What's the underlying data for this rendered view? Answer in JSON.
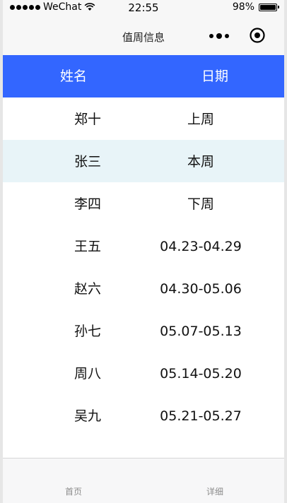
{
  "status_bar": {
    "carrier": "WeChat",
    "time": "22:55",
    "battery": "98%",
    "battery_level": 0.98
  },
  "nav": {
    "title": "值周信息",
    "more_icon": "more-dots-icon",
    "close_icon": "target-close-icon"
  },
  "table": {
    "headers": [
      "姓名",
      "日期"
    ],
    "rows": [
      {
        "name": "郑十",
        "date": "上周"
      },
      {
        "name": "张三",
        "date": "本周",
        "highlight": true
      },
      {
        "name": "李四",
        "date": "下周"
      },
      {
        "name": "王五",
        "date": "04.23-04.29"
      },
      {
        "name": "赵六",
        "date": "04.30-05.06"
      },
      {
        "name": "孙七",
        "date": "05.07-05.13"
      },
      {
        "name": "周八",
        "date": "05.14-05.20"
      },
      {
        "name": "吴九",
        "date": "05.21-05.27"
      }
    ]
  },
  "tab_bar": {
    "items": [
      {
        "label": "首页"
      },
      {
        "label": "详细"
      }
    ]
  },
  "colors": {
    "header_bg": "#3366ff",
    "highlight_row": "#e8f4f8"
  }
}
